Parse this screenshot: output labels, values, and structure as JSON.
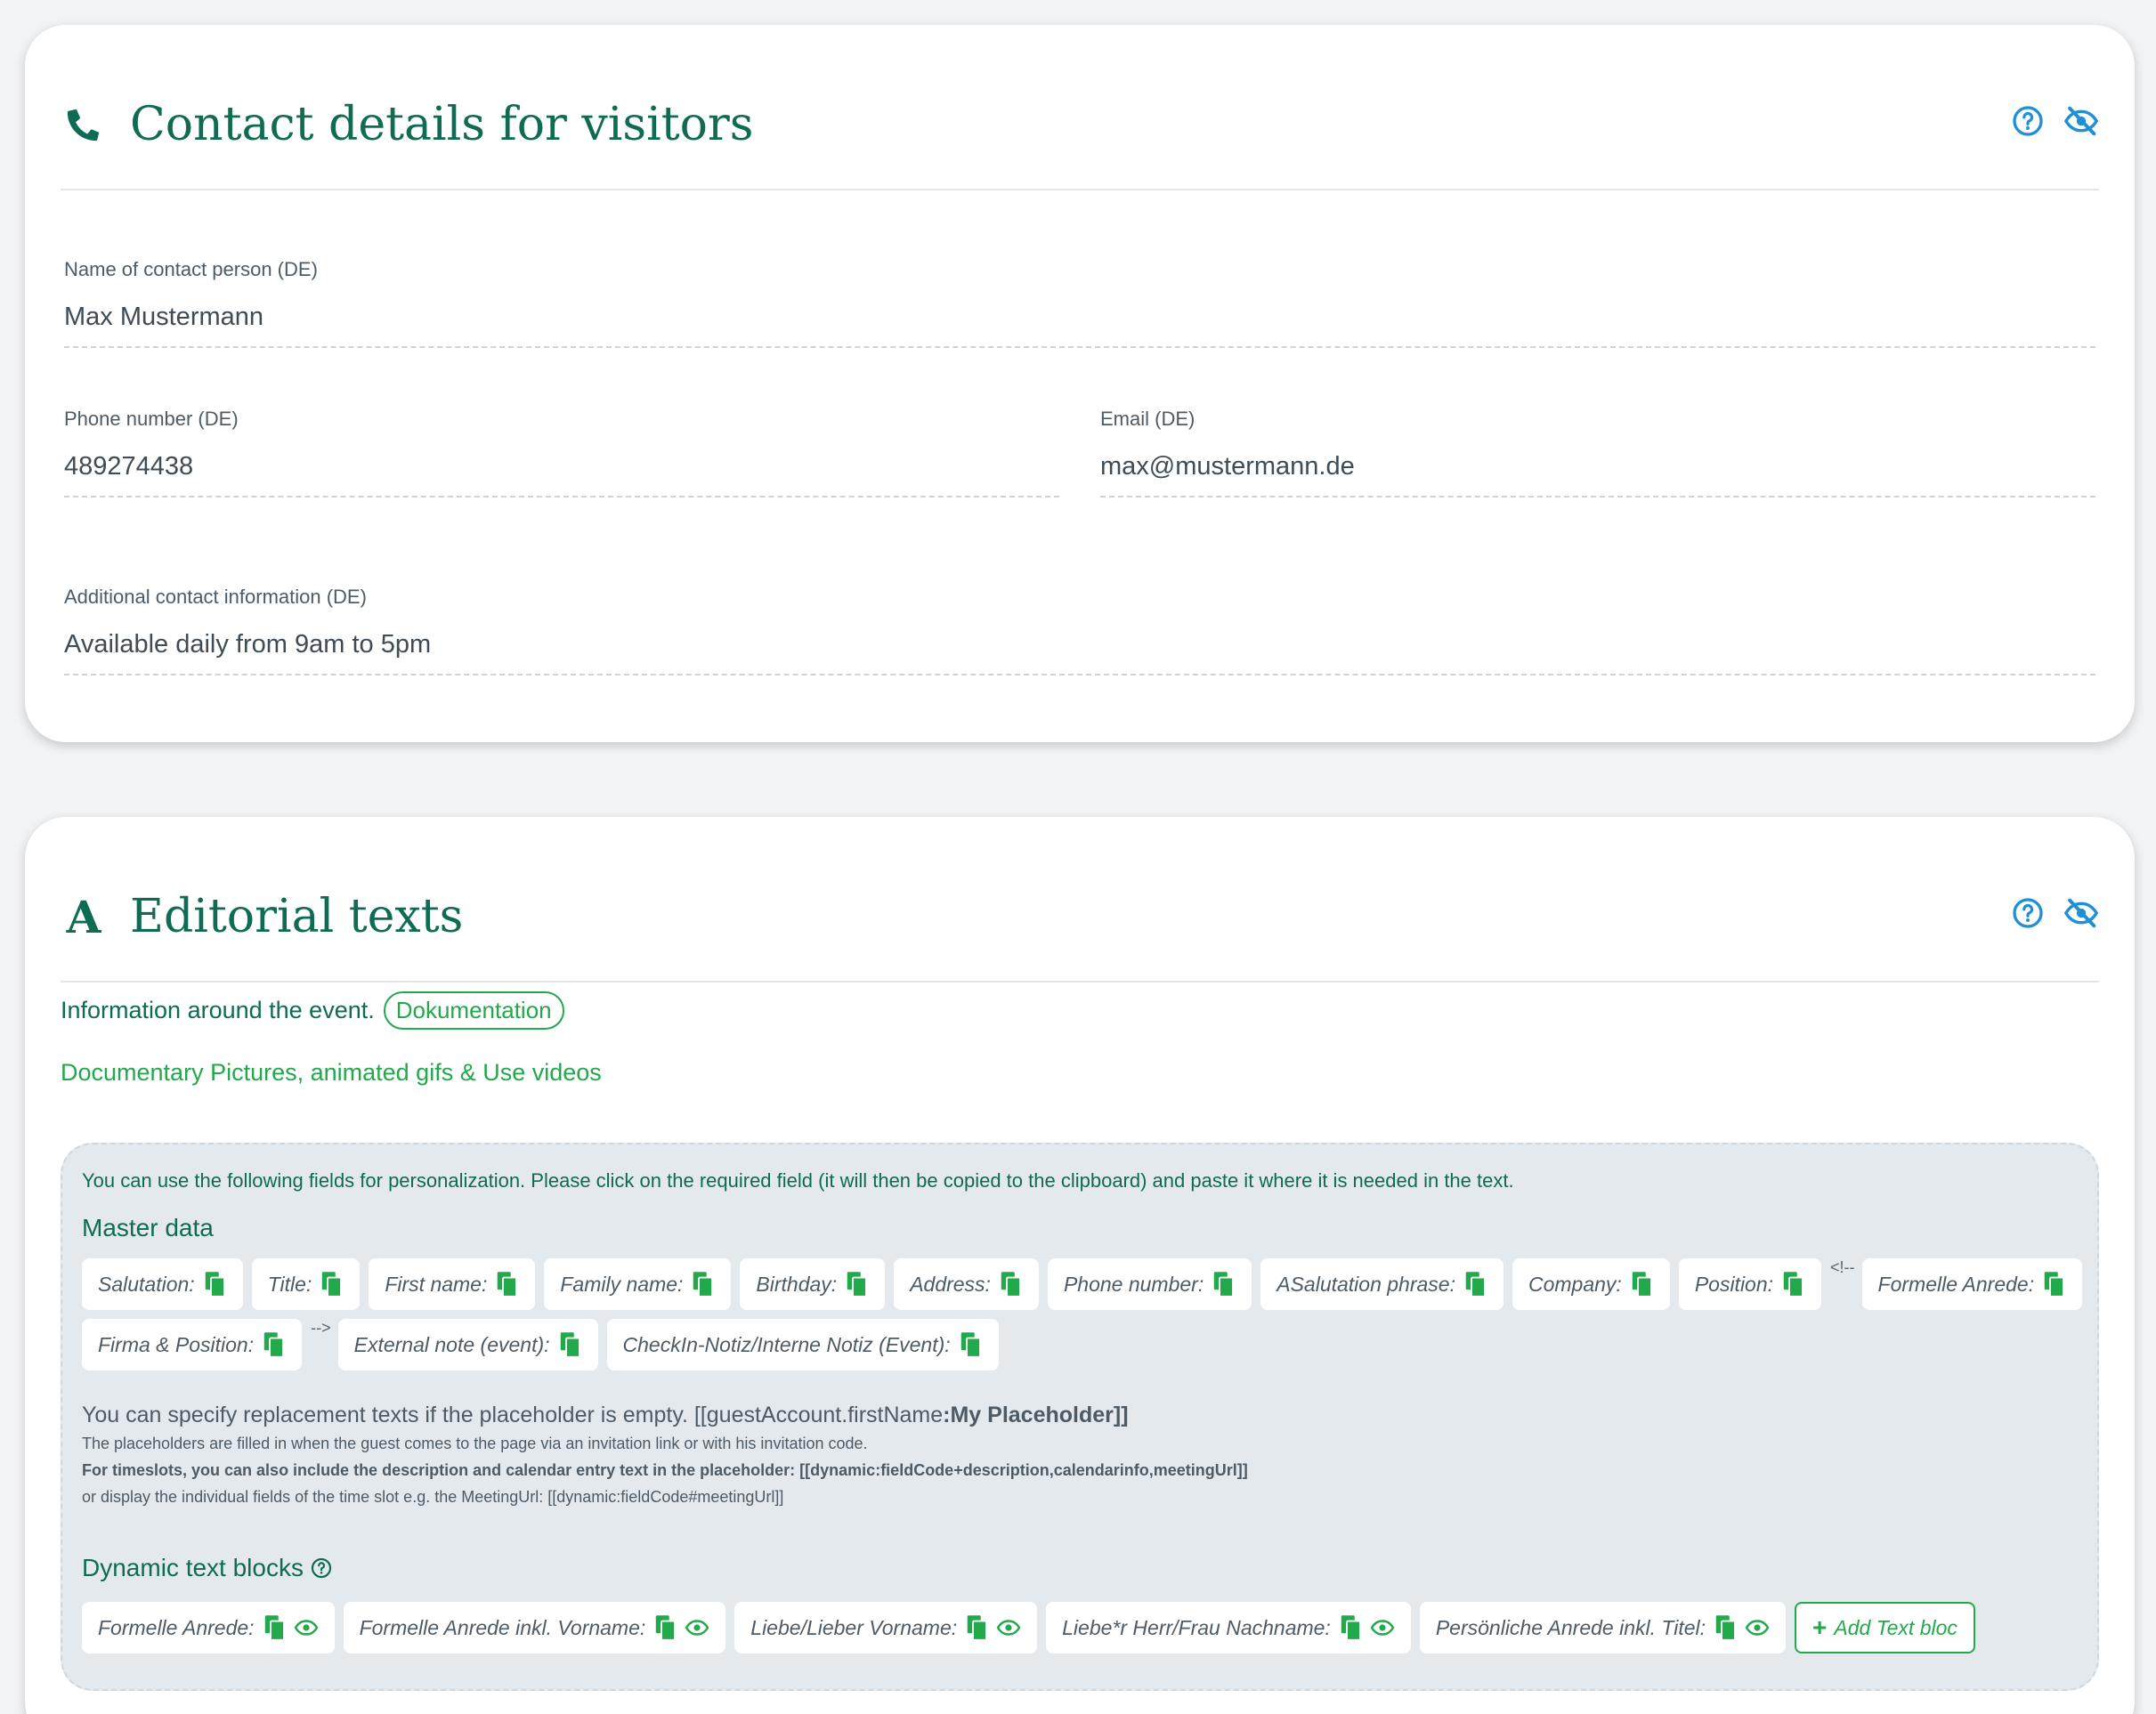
{
  "contact": {
    "title": "Contact details for visitors",
    "fields": {
      "contact_name": {
        "label": "Name of contact person (DE)",
        "value": "Max Mustermann"
      },
      "phone": {
        "label": "Phone number (DE)",
        "value": "489274438"
      },
      "email": {
        "label": "Email (DE)",
        "value": "max@mustermann.de"
      },
      "additional": {
        "label": "Additional contact information (DE)",
        "value": "Available daily from 9am to 5pm"
      }
    }
  },
  "editorial": {
    "title": "Editorial texts",
    "title_glyph": "A",
    "intro": "Information around the event.",
    "doc_pill": "Dokumentation",
    "doc_link": "Documentary Pictures, animated gifs & Use videos",
    "panel": {
      "intro": "You can use the following fields for personalization. Please click on the required field (it will then be copied to the clipboard) and paste it where it is needed in the text.",
      "master_heading": "Master data",
      "master_row1": [
        "Salutation:",
        "Title:",
        "First name:",
        "Family name:",
        "Birthday:",
        "Address:",
        "Phone number:",
        "ASalutation phrase:",
        "Company:",
        "Position:"
      ],
      "comment_open": "<!--",
      "comment_close": "-->",
      "formal": "Formelle Anrede:",
      "master_row2": [
        "Firma & Position:"
      ],
      "master_row2b": [
        "External note (event):",
        "CheckIn-Notiz/Interne Notiz (Event):"
      ],
      "replace_prefix": "You can specify replacement texts if the placeholder is empty. [[guestAccount.firstName",
      "replace_bold": ":My Placeholder]]",
      "note1": "The placeholders are filled in when the guest comes to the page via an invitation link or with his invitation code.",
      "note2": "For timeslots, you can also include the description and calendar entry text in the placeholder: [[dynamic:fieldCode+description,calendarinfo,meetingUrl]]",
      "note3": "or display the individual fields of the time slot e.g. the MeetingUrl: [[dynamic:fieldCode#meetingUrl]]",
      "dynamic_heading": "Dynamic text blocks",
      "dynamic_blocks": [
        "Formelle Anrede:",
        "Formelle Anrede inkl. Vorname:",
        "Liebe/Lieber Vorname:",
        "Liebe*r Herr/Frau Nachname:",
        "Persönliche Anrede inkl. Titel:"
      ],
      "add_button": "Add Text bloc"
    }
  },
  "icons": {
    "phone": "phone-icon",
    "help": "help-circle-icon",
    "visibility": "eye-slash-icon",
    "copy": "copy-icon",
    "preview": "eye-icon",
    "plus": "plus-icon"
  },
  "colors": {
    "title_green": "#0f6b53",
    "accent_green": "#22a94b",
    "icon_blue": "#1f8fd8"
  }
}
